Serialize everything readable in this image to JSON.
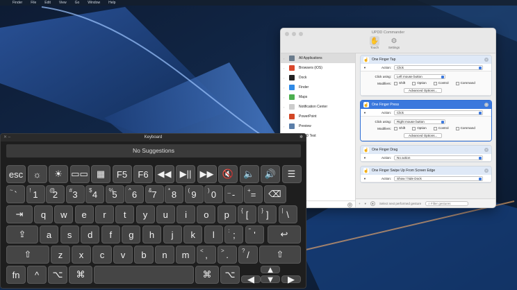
{
  "menubar": {
    "items": [
      "",
      "Finder",
      "File",
      "Edit",
      "View",
      "Go",
      "Window",
      "Help"
    ],
    "clock": ""
  },
  "updd": {
    "title": "UPDD Commander",
    "tabs": [
      {
        "label": "Touch",
        "icon": "hand-icon"
      },
      {
        "label": "Settings",
        "icon": "gear-icon"
      }
    ],
    "apps": [
      {
        "label": "All Applications",
        "color": "#6a7b8c"
      },
      {
        "label": "Browsers (iOS)",
        "color": "#d9472b"
      },
      {
        "label": "Dock",
        "color": "#222222"
      },
      {
        "label": "Finder",
        "color": "#2f8ae6"
      },
      {
        "label": "Maps",
        "color": "#4caf50"
      },
      {
        "label": "Notification Center",
        "color": "#cccccc"
      },
      {
        "label": "PowerPoint",
        "color": "#d24726"
      },
      {
        "label": "Preview",
        "color": "#5b7ea8"
      },
      {
        "label": "UPDD Test",
        "color": "#444444"
      }
    ],
    "gestures": [
      {
        "name": "One Finger Tap",
        "action_label": "Action:",
        "action": "Click",
        "click_using_label": "Click using:",
        "click_using": "Left mouse button",
        "modifiers_label": "Modifiers:",
        "modifiers": [
          "Shift",
          "Option",
          "Control",
          "Command"
        ],
        "advanced": "Advanced Options..."
      },
      {
        "name": "One Finger Press",
        "action_label": "Action:",
        "action": "Click",
        "click_using_label": "Click using:",
        "click_using": "Right mouse button",
        "modifiers_label": "Modifiers:",
        "modifiers": [
          "Shift",
          "Option",
          "Control",
          "Command"
        ],
        "advanced": "Advanced Options..."
      },
      {
        "name": "One Finger Drag",
        "action_label": "Action:",
        "action": "No action"
      },
      {
        "name": "One Finger Swipe Up From Screen Edge",
        "action_label": "Action:",
        "action": "Show / hide Dock"
      }
    ],
    "footer": {
      "add": "+",
      "next_hint": "Select next performed gesture",
      "filter_placeholder": "Filter gestures"
    }
  },
  "keyboard": {
    "title": "Keyboard",
    "suggestions": "No Suggestions",
    "fn_row": [
      "esc",
      "☼",
      "☀",
      "▭▭",
      "▦",
      "F5",
      "F6",
      "◀◀",
      "▶||",
      "▶▶",
      "🔇",
      "🔈",
      "🔊",
      "☰"
    ],
    "num_row": [
      {
        "top": "~",
        "main": "`"
      },
      {
        "top": "!",
        "main": "1"
      },
      {
        "top": "@",
        "main": "2"
      },
      {
        "top": "#",
        "main": "3"
      },
      {
        "top": "$",
        "main": "4"
      },
      {
        "top": "%",
        "main": "5"
      },
      {
        "top": "^",
        "main": "6"
      },
      {
        "top": "&",
        "main": "7"
      },
      {
        "top": "*",
        "main": "8"
      },
      {
        "top": "(",
        "main": "9"
      },
      {
        "top": ")",
        "main": "0"
      },
      {
        "top": "_",
        "main": "-"
      },
      {
        "top": "+",
        "main": "="
      },
      {
        "top": "",
        "main": "⌫"
      }
    ],
    "q_row": [
      "⇥",
      "q",
      "w",
      "e",
      "r",
      "t",
      "y",
      "u",
      "i",
      "o",
      "p",
      "[",
      "]",
      "\\"
    ],
    "q_row_tops": [
      "",
      "",
      "",
      "",
      "",
      "",
      "",
      "",
      "",
      "",
      "",
      "{",
      "}",
      "|"
    ],
    "a_row": [
      "⇪",
      "a",
      "s",
      "d",
      "f",
      "g",
      "h",
      "j",
      "k",
      "l",
      ";",
      "'",
      "↩"
    ],
    "a_row_tops": [
      "",
      "",
      "",
      "",
      "",
      "",
      "",
      "",
      "",
      "",
      ":",
      "\"",
      ""
    ],
    "z_row": [
      "⇧",
      "z",
      "x",
      "c",
      "v",
      "b",
      "n",
      "m",
      ",",
      ".",
      "/",
      "⇧"
    ],
    "z_row_tops": [
      "",
      "",
      "",
      "",
      "",
      "",
      "",
      "",
      "<",
      ">",
      "?",
      ""
    ],
    "bottom_row": [
      "fn",
      "^",
      "⌥",
      "⌘",
      "",
      "⌘",
      "⌥"
    ],
    "arrows": [
      "▲",
      "◀",
      "▼",
      "▶"
    ]
  }
}
